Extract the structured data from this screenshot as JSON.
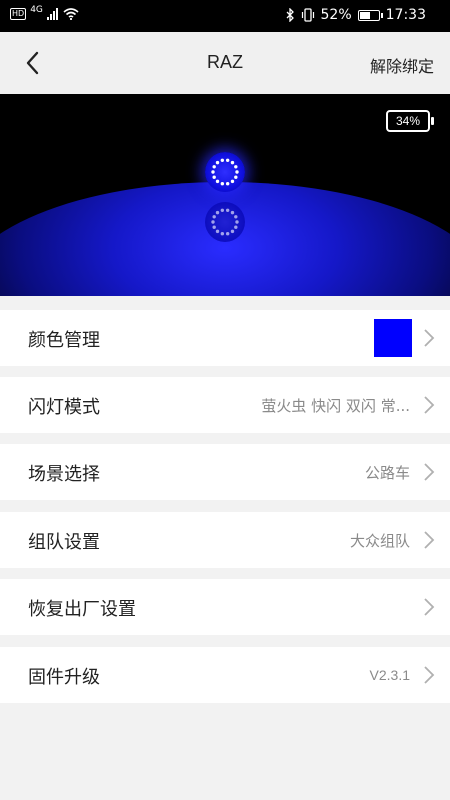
{
  "status_bar": {
    "hd": "HD",
    "network": "4G",
    "battery_percent": "52%",
    "battery_level": 0.52,
    "time": "17:33"
  },
  "header": {
    "title": "RAZ",
    "action_label": "解除绑定"
  },
  "device_preview": {
    "battery_label": "34%",
    "light_color": "#0000ff"
  },
  "settings": {
    "color_management": {
      "label": "颜色管理",
      "swatch_color": "#0000ff"
    },
    "flash_mode": {
      "label": "闪灯模式",
      "value": "萤火虫 快闪 双闪 常..."
    },
    "scene_select": {
      "label": "场景选择",
      "value": "公路车"
    },
    "team_settings": {
      "label": "组队设置",
      "value": "大众组队"
    },
    "factory_reset": {
      "label": "恢复出厂设置"
    },
    "firmware_upgrade": {
      "label": "固件升级",
      "value": "V2.3.1"
    }
  },
  "icons": {
    "back": "chevron-left-icon",
    "chevron": "chevron-right-icon"
  }
}
